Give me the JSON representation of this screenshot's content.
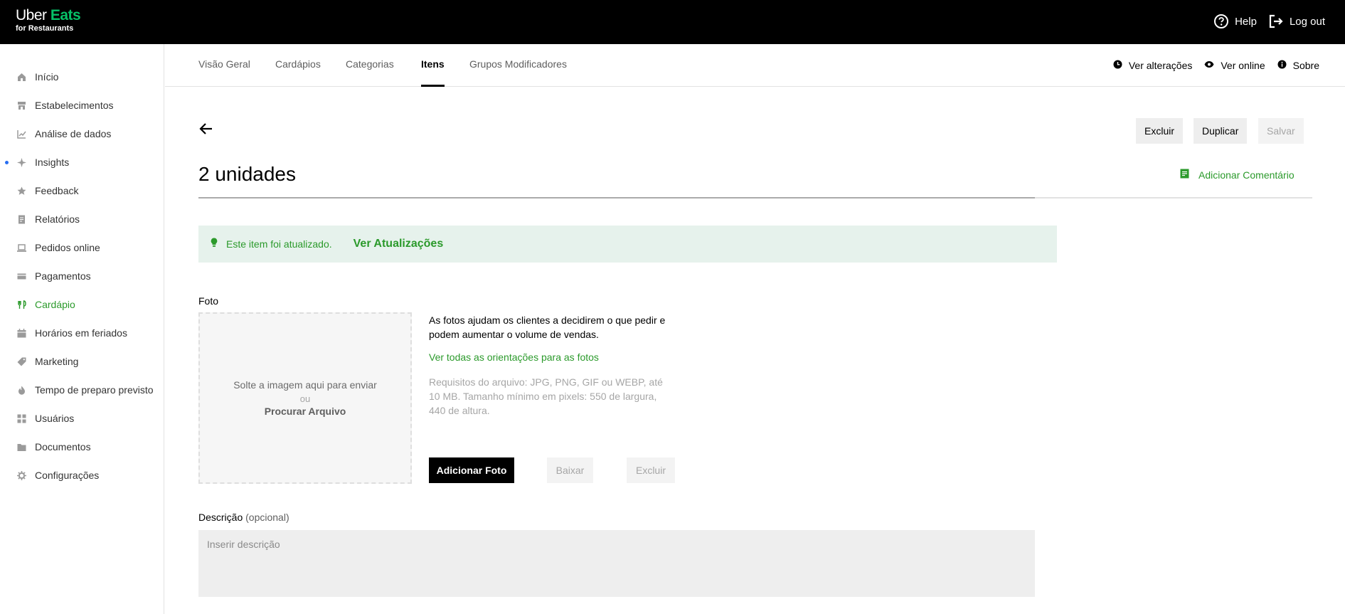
{
  "header": {
    "logo_uber": "Uber",
    "logo_eats": "Eats",
    "logo_sub": "for Restaurants",
    "help_label": "Help",
    "logout_label": "Log out"
  },
  "sidebar": {
    "items": [
      {
        "label": "Início",
        "icon": "home-icon"
      },
      {
        "label": "Estabelecimentos",
        "icon": "store-icon"
      },
      {
        "label": "Análise de dados",
        "icon": "chart-icon"
      },
      {
        "label": "Insights",
        "icon": "sparkle-icon",
        "has_dot": true
      },
      {
        "label": "Feedback",
        "icon": "star-icon"
      },
      {
        "label": "Relatórios",
        "icon": "report-icon"
      },
      {
        "label": "Pedidos online",
        "icon": "laptop-icon"
      },
      {
        "label": "Pagamentos",
        "icon": "card-icon"
      },
      {
        "label": "Cardápio",
        "icon": "utensils-icon",
        "active": true
      },
      {
        "label": "Horários em feriados",
        "icon": "calendar-icon"
      },
      {
        "label": "Marketing",
        "icon": "tag-icon"
      },
      {
        "label": "Tempo de preparo previsto",
        "icon": "flame-icon"
      },
      {
        "label": "Usuários",
        "icon": "users-icon"
      },
      {
        "label": "Documentos",
        "icon": "folder-icon"
      },
      {
        "label": "Configurações",
        "icon": "gear-icon"
      }
    ]
  },
  "tabs": [
    {
      "label": "Visão Geral"
    },
    {
      "label": "Cardápios"
    },
    {
      "label": "Categorias"
    },
    {
      "label": "Itens",
      "active": true
    },
    {
      "label": "Grupos Modificadores"
    }
  ],
  "tab_actions": {
    "changes_label": "Ver alterações",
    "online_label": "Ver online",
    "about_label": "Sobre"
  },
  "item": {
    "title": "2 unidades",
    "delete_label": "Excluir",
    "duplicate_label": "Duplicar",
    "save_label": "Salvar",
    "add_comment_label": "Adicionar Comentário"
  },
  "banner": {
    "text": "Este item foi atualizado.",
    "link": "Ver Atualizações"
  },
  "photo": {
    "label": "Foto",
    "drop_text": "Solte a imagem aqui para enviar",
    "or_text": "ou",
    "browse_label": "Procurar Arquivo",
    "description": "As fotos ajudam os clientes a decidirem o que pedir e podem aumentar o volume de vendas.",
    "guidelines_link": "Ver todas as orientações para as fotos",
    "requirements": "Requisitos do arquivo: JPG, PNG, GIF ou WEBP, até 10 MB. Tamanho mínimo em pixels: 550 de largura, 440 de altura.",
    "add_label": "Adicionar Foto",
    "download_label": "Baixar",
    "delete_label": "Excluir"
  },
  "description": {
    "label": "Descrição",
    "optional": "(opcional)",
    "placeholder": "Inserir descrição",
    "value": ""
  },
  "colors": {
    "brand_green": "#06c167",
    "accent_green": "#2b9a2b",
    "banner_bg": "#e6f2ec",
    "notification_dot": "#276ef1"
  }
}
